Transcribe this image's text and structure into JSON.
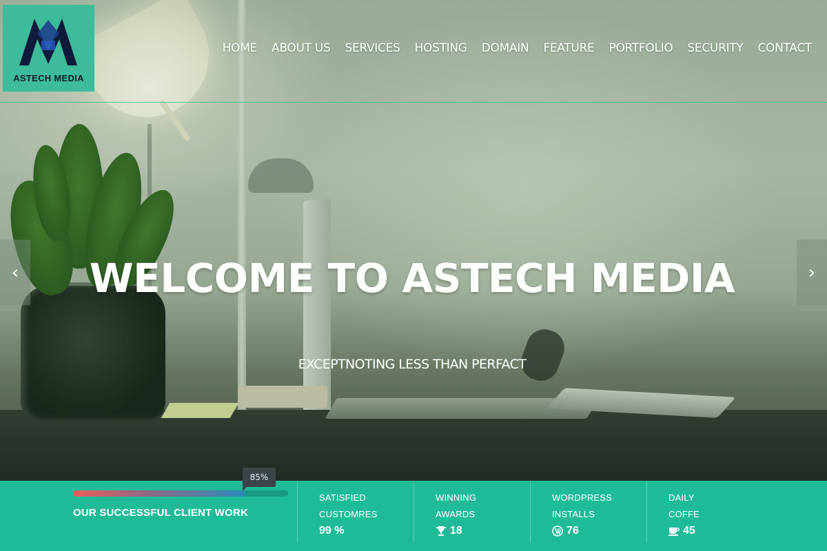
{
  "brand": {
    "name": "ASTECH MEDIA",
    "accent": "#1fbb99"
  },
  "nav": {
    "items": [
      "HOME",
      "ABOUT US",
      "SERVICES",
      "HOSTING",
      "DOMAIN",
      "FEATURE",
      "PORTFOLIO",
      "SECURITY",
      "CONTACT"
    ]
  },
  "hero": {
    "title": "WELCOME TO ASTECH MEDIA",
    "subtitle": "EXCEPTNOTING LESS THAN PERFACT",
    "prev_icon": "chevron-left-icon",
    "next_icon": "chevron-right-icon",
    "prev_glyph": "‹",
    "next_glyph": "›"
  },
  "stats": {
    "progress": {
      "label": "OUR SUCCESSFUL CLIENT WORK",
      "percent_text": "85%",
      "fraction": 0.8
    },
    "items": [
      {
        "line1": "SATISFIED",
        "line2": "CUSTOMRES",
        "value": "99 %",
        "icon": ""
      },
      {
        "line1": "WINNING",
        "line2": "AWARDS",
        "value": "18",
        "icon": "trophy-icon"
      },
      {
        "line1": "WORDPRESS",
        "line2": "INSTALLS",
        "value": "76",
        "icon": "wordpress-icon"
      },
      {
        "line1": "DAILY",
        "line2": "COFFE",
        "value": "45",
        "icon": "coffee-icon"
      }
    ]
  }
}
